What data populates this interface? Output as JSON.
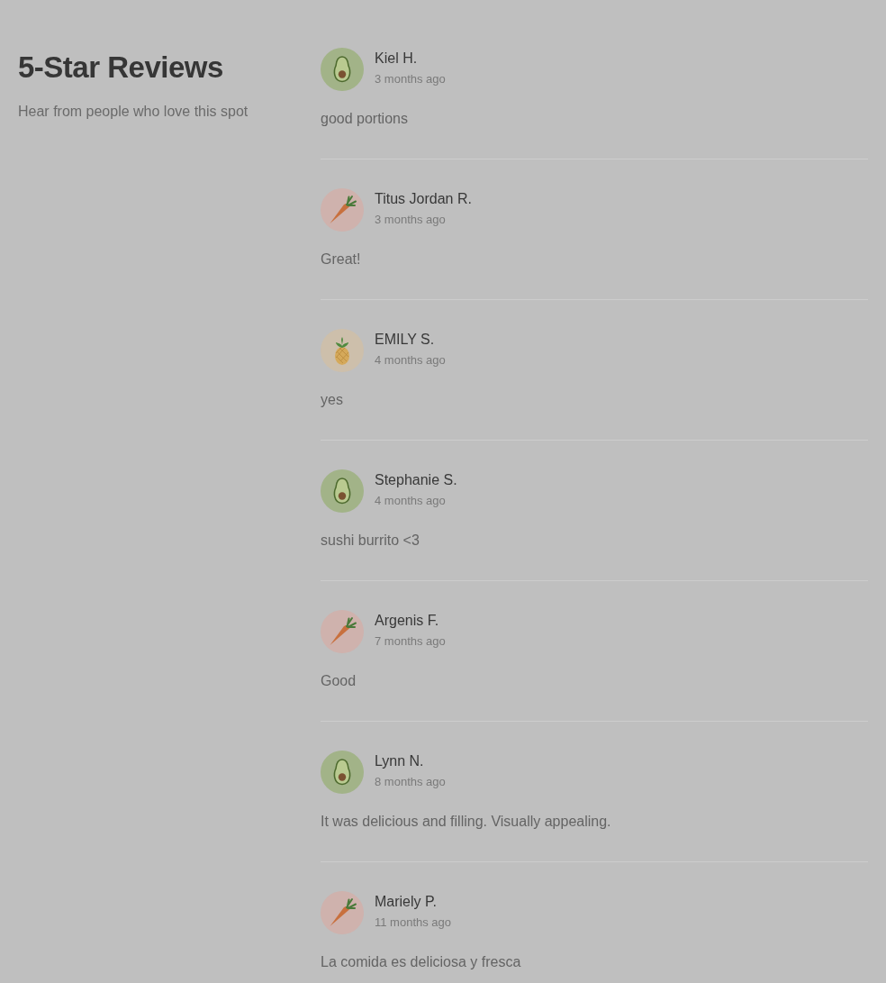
{
  "header": {
    "title": "5-Star Reviews",
    "subtitle": "Hear from people who love this spot"
  },
  "reviews": [
    {
      "name": "Kiel H.",
      "time": "3 months ago",
      "text": "good portions",
      "avatar": {
        "kind": "avocado"
      }
    },
    {
      "name": "Titus Jordan R.",
      "time": "3 months ago",
      "text": "Great!",
      "avatar": {
        "kind": "carrot"
      }
    },
    {
      "name": "EMILY S.",
      "time": "4 months ago",
      "text": "yes",
      "avatar": {
        "kind": "pineapple"
      }
    },
    {
      "name": "Stephanie S.",
      "time": "4 months ago",
      "text": "sushi burrito <3",
      "avatar": {
        "kind": "avocado"
      }
    },
    {
      "name": "Argenis F.",
      "time": "7 months ago",
      "text": "Good",
      "avatar": {
        "kind": "carrot"
      }
    },
    {
      "name": "Lynn N.",
      "time": "8 months ago",
      "text": "It was delicious and filling. Visually appealing.",
      "avatar": {
        "kind": "avocado"
      }
    },
    {
      "name": "Mariely P.",
      "time": "11 months ago",
      "text": "La comida es deliciosa y fresca",
      "avatar": {
        "kind": "carrot"
      }
    }
  ]
}
